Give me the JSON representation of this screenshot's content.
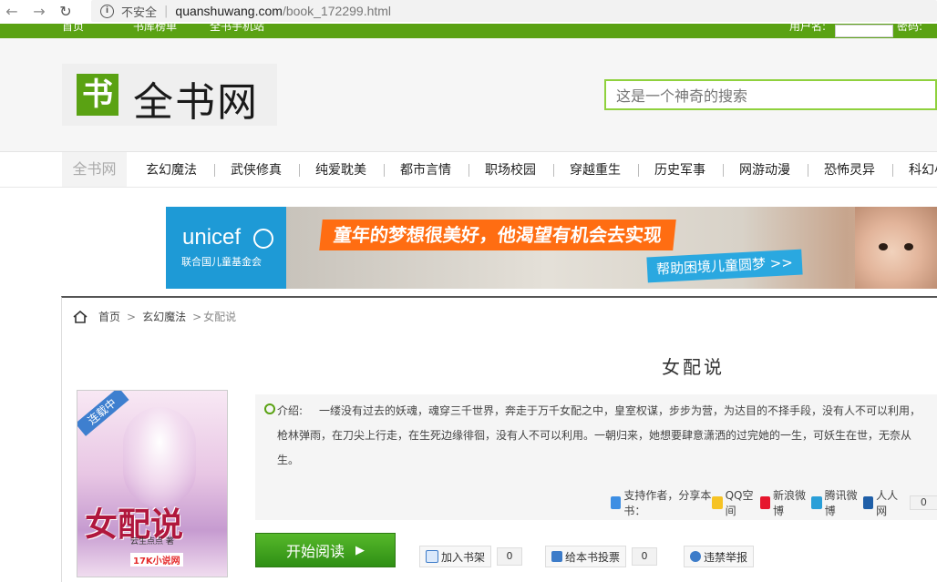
{
  "browser": {
    "insecure_label": "不安全",
    "url_host": "quanshuwang.com",
    "url_path": "/book_172299.html"
  },
  "topbar": {
    "links": [
      "首页",
      "书库榜单",
      "全书手机站"
    ],
    "username_label": "用户名:",
    "password_label": "密码:"
  },
  "header": {
    "logo_mark": "书",
    "logo_text": "全书网",
    "search_placeholder": "这是一个神奇的搜索"
  },
  "catnav": {
    "home": "全书网",
    "items": [
      "玄幻魔法",
      "武侠修真",
      "纯爱耽美",
      "都市言情",
      "职场校园",
      "穿越重生",
      "历史军事",
      "网游动漫",
      "恐怖灵异",
      "科幻小"
    ]
  },
  "banner": {
    "brand": "unicef",
    "brand_cn": "联合国儿童基金会",
    "slogan": "童年的梦想很美好，他渴望有机会去实现",
    "cta": "帮助困境儿童圆梦 >>"
  },
  "breadcrumb": {
    "home": "首页",
    "category": "玄幻魔法",
    "current": "女配说"
  },
  "book": {
    "title": "女配说",
    "status_ribbon": "连载中",
    "cover_title": "女配说",
    "cover_author": "云生点点 著",
    "cover_logo": "17K小说网",
    "intro_label": "介绍:",
    "intro": "一缕没有过去的妖魂，魂穿三千世界，奔走于万千女配之中，皇室权谋，步步为营，为达目的不择手段，没有人不可以利用，枪林弹雨，在刀尖上行走，在生死边缘徘徊，没有人不可以利用。一朝归来，她想要肆意潇洒的过完她的一生，可妖生在世，无奈从生。"
  },
  "share": {
    "support": "支持作者，分享本书：",
    "qq": "QQ空间",
    "weibo": "新浪微博",
    "tencent": "腾讯微博",
    "renren": "人人网",
    "count": "0"
  },
  "actions": {
    "read": "开始阅读",
    "bookshelf": "加入书架",
    "bookshelf_count": "0",
    "vote": "给本书投票",
    "vote_count": "0",
    "report": "违禁举报"
  },
  "colors": {
    "brand_green": "#5aa213",
    "search_border": "#8fd13d",
    "banner_orange": "#ff6d12",
    "banner_blue": "#1e9ad6"
  }
}
